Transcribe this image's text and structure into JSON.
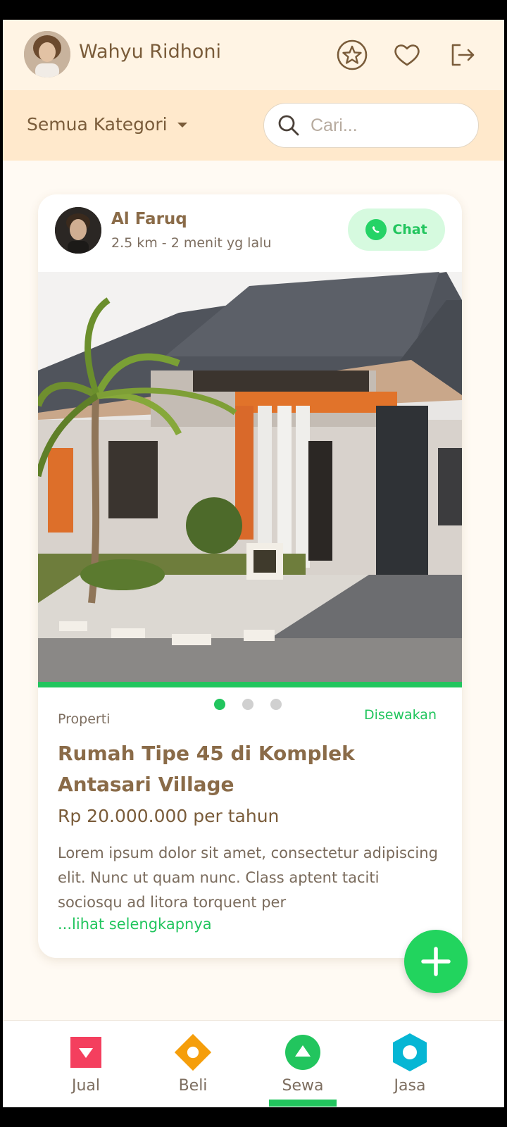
{
  "header": {
    "user_name": "Wahyu Ridhoni"
  },
  "filter": {
    "category_label": "Semua Kategori",
    "search_placeholder": "Cari..."
  },
  "post": {
    "seller_name": "Al Faruq",
    "seller_meta": "2.5 km  - 2 menit yg lalu",
    "chat_label": "Chat",
    "category": "Properti",
    "status": "Disewakan",
    "title": "Rumah Tipe 45 di Komplek Antasari Village",
    "price": "Rp 20.000.000 per tahun",
    "description": "Lorem ipsum dolor sit amet, consectetur adipiscing elit. Nunc ut quam nunc. Class aptent taciti sociosqu ad litora torquent per",
    "more_link": "...lihat selengkapnya",
    "active_slide": 1,
    "slide_count": 3
  },
  "bottom_nav": {
    "items": [
      {
        "label": "Jual",
        "color": "#f43f5e"
      },
      {
        "label": "Beli",
        "color": "#f59e0b"
      },
      {
        "label": "Sewa",
        "color": "#22c55e"
      },
      {
        "label": "Jasa",
        "color": "#06b6d4"
      }
    ],
    "active_index": 2
  },
  "colors": {
    "accent": "#22c55e",
    "brown_text": "#8a6b48",
    "header_bg": "#fff4e4",
    "filter_bg": "#ffe9cc"
  }
}
